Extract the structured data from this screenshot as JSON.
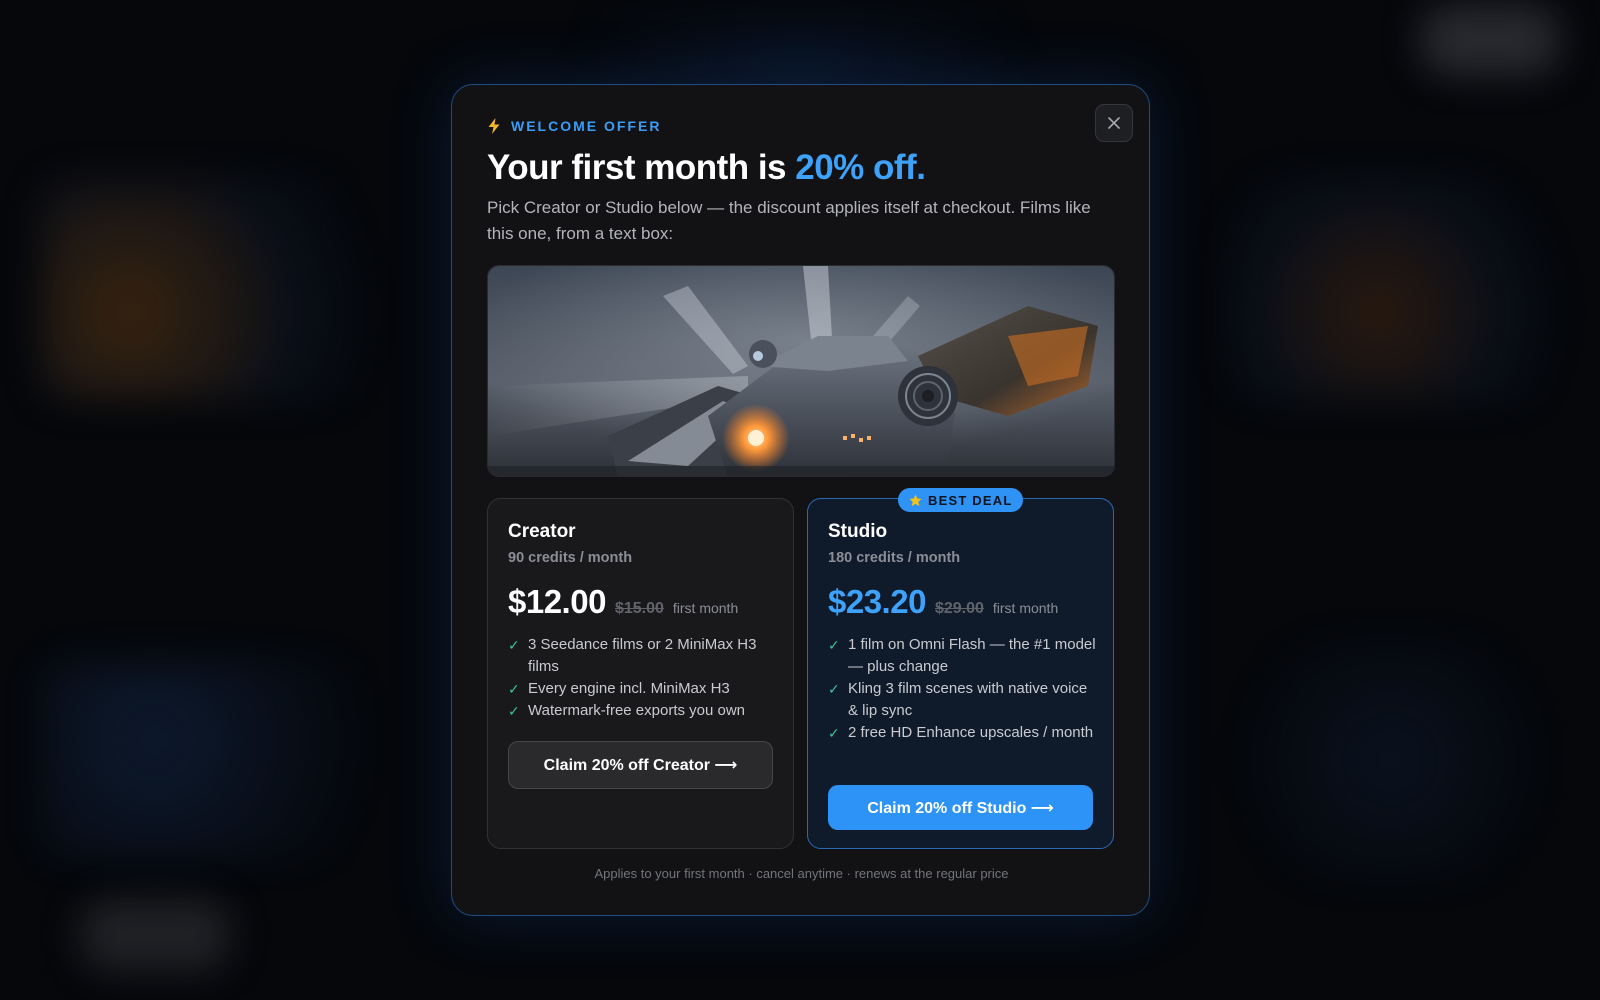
{
  "modal": {
    "eyebrow_icon": "bolt-icon",
    "eyebrow": "WELCOME OFFER",
    "title_prefix": "Your first month is ",
    "title_accent": "20% off.",
    "subtitle": "Pick Creator or Studio below — the discount applies itself at checkout. Films like this one, from a text box:",
    "close_icon": "close-icon",
    "footnote": "Applies to your first month · cancel anytime · renews at the regular price"
  },
  "plans": {
    "creator": {
      "name": "Creator",
      "credits": "90 credits / month",
      "price": "$12.00",
      "old_price": "$15.00",
      "price_note": "first month",
      "features": [
        "3 Seedance films or 2 MiniMax H3 films",
        "Every engine incl. MiniMax H3",
        "Watermark-free exports you own"
      ],
      "cta": "Claim 20% off Creator ⟶"
    },
    "studio": {
      "badge": "BEST DEAL",
      "badge_icon": "star-icon",
      "name": "Studio",
      "credits": "180 credits / month",
      "price": "$23.20",
      "old_price": "$29.00",
      "price_note": "first month",
      "features": [
        "1 film on Omni Flash — the #1 model — plus change",
        "Kling 3 film scenes with native voice & lip sync",
        "2 free HD Enhance upscales / month"
      ],
      "cta": "Claim 20% off Studio ⟶"
    }
  },
  "colors": {
    "accent": "#3ea2fb",
    "check": "#38c49a",
    "studio_border": "#2a6ab3"
  }
}
